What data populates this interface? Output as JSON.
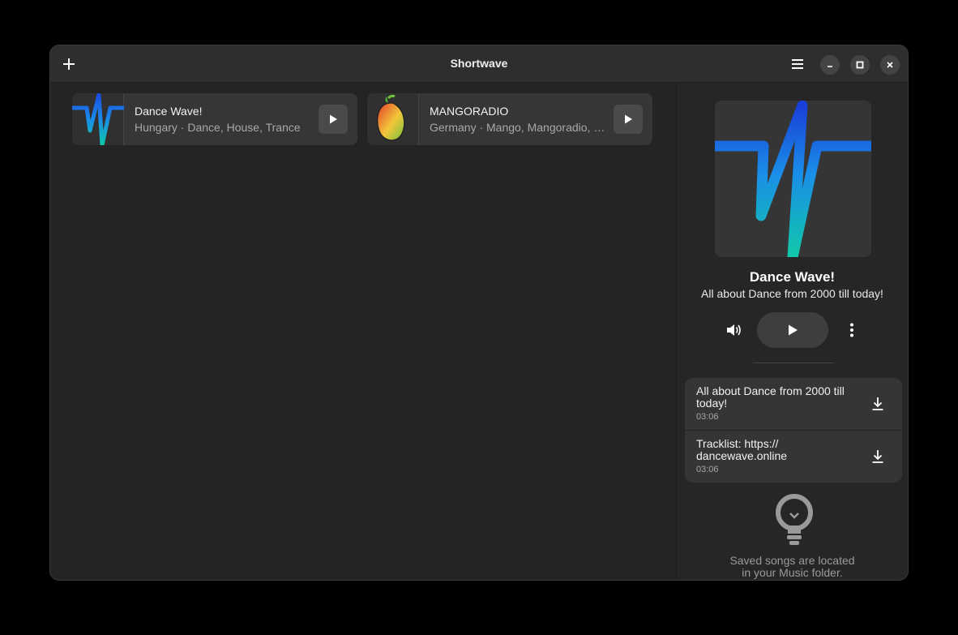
{
  "window": {
    "title": "Shortwave"
  },
  "icons": {
    "add": "plus-icon",
    "menu": "hamburger-menu-icon",
    "minimize": "minimize-icon",
    "maximize": "maximize-icon",
    "close": "close-icon",
    "play": "play-icon",
    "volume": "volume-icon",
    "more": "vertical-dots-icon",
    "download": "download-icon",
    "tip": "lightbulb-icon"
  },
  "library": {
    "stations": [
      {
        "name": "Dance Wave!",
        "subtitle": "Hungary · Dance, House, Trance"
      },
      {
        "name": "MANGORADIO",
        "subtitle": "Germany · Mango, Mangoradio, Music"
      }
    ]
  },
  "player": {
    "station_name": "Dance Wave!",
    "station_description": "All about Dance from 2000 till today!",
    "songs": [
      {
        "title": "All about Dance from 2000 till today!",
        "duration": "03:06"
      },
      {
        "title": "Tracklist: https:// dancewave.online",
        "duration": "03:06"
      }
    ],
    "hint_line1": "Saved songs are located",
    "hint_line2": "in your Music folder."
  },
  "colors": {
    "wave_top": "#1a5fe6",
    "wave_bottom": "#10c8a8",
    "mango_red": "#e33b2a",
    "mango_yellow": "#f2c73a",
    "mango_green": "#6fbf3a"
  }
}
